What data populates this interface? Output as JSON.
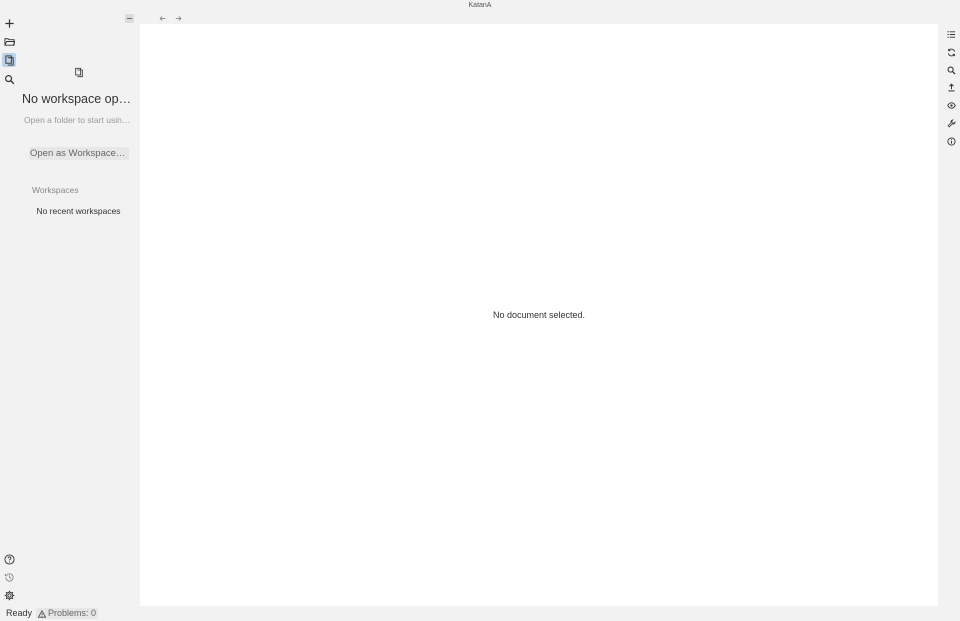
{
  "window": {
    "title": "KatanA"
  },
  "left_rail": {
    "items": [
      {
        "name": "new-file",
        "icon": "plus-icon"
      },
      {
        "name": "open-folder",
        "icon": "folder-open-icon"
      },
      {
        "name": "explorer",
        "icon": "files-icon",
        "active": true
      },
      {
        "name": "search",
        "icon": "search-icon"
      }
    ],
    "bottom_items": [
      {
        "name": "help",
        "icon": "help-circle-icon"
      },
      {
        "name": "history",
        "icon": "history-icon"
      },
      {
        "name": "settings",
        "icon": "gear-icon"
      }
    ]
  },
  "sidebar": {
    "title": "No workspace opened",
    "subtitle": "Open a folder to start using the workspace",
    "open_button": "Open as Workspace…",
    "workspaces_heading": "Workspaces",
    "empty_recent": "No recent workspaces"
  },
  "editor": {
    "empty_message": "No document selected."
  },
  "right_rail": {
    "items": [
      {
        "name": "outline",
        "icon": "list-icon"
      },
      {
        "name": "refresh",
        "icon": "refresh-icon"
      },
      {
        "name": "search",
        "icon": "search-icon"
      },
      {
        "name": "export",
        "icon": "upload-icon"
      },
      {
        "name": "preview",
        "icon": "eye-icon"
      },
      {
        "name": "tools",
        "icon": "wrench-icon"
      },
      {
        "name": "info",
        "icon": "info-icon"
      }
    ]
  },
  "statusbar": {
    "status": "Ready",
    "problems": "Problems: 0"
  },
  "colors": {
    "background": "#f2f2f2",
    "editor": "#ffffff",
    "active_rail": "#bcd2ea"
  }
}
